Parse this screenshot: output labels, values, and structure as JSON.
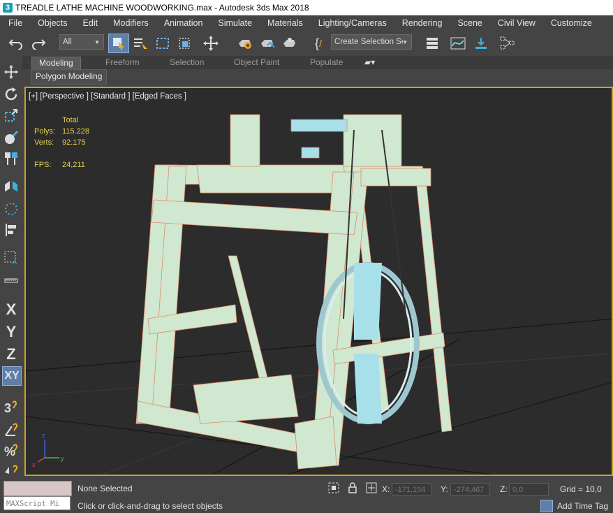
{
  "window": {
    "title": "TREADLE LATHE MACHINE WOODWORKING.max - Autodesk 3ds Max 2018",
    "logo": "3"
  },
  "menu": [
    "File",
    "Objects",
    "Edit",
    "Modifiers",
    "Animation",
    "Simulate",
    "Materials",
    "Lighting/Cameras",
    "Rendering",
    "Scene",
    "Civil View",
    "Customize"
  ],
  "toolbar": {
    "filter_value": "All",
    "selection_set_value": "Create Selection Se"
  },
  "ribbon": {
    "tabs": [
      "Modeling",
      "Freeform",
      "Selection",
      "Object Paint",
      "Populate"
    ],
    "panel_label": "Polygon Modeling"
  },
  "side_letters": [
    "X",
    "Y",
    "Z",
    "XY"
  ],
  "viewport": {
    "label": "[+] [Perspective ] [Standard ] [Edged Faces ]",
    "stats": {
      "header": "Total",
      "polys_label": "Polys:",
      "polys": "115.228",
      "verts_label": "Verts:",
      "verts": "92.175",
      "fps_label": "FPS:",
      "fps": "24,211"
    },
    "axis": {
      "x": "x",
      "y": "y",
      "z": "z"
    }
  },
  "status": {
    "selection": "None Selected",
    "prompt": "Click or click-and-drag to select objects",
    "maxscript_placeholder": "MAXScript Mi",
    "x_label": "X:",
    "x": "-171,154",
    "y_label": "Y:",
    "y": "-274,467",
    "z_label": "Z:",
    "z": "0,0",
    "grid": "Grid = 10,0",
    "time_tag": "Add Time Tag"
  },
  "colors": {
    "viewport_border": "#c9a227",
    "model_fill": "#cfe8cf",
    "model_edge": "#e08a6a",
    "stats_text": "#e6d24a"
  }
}
